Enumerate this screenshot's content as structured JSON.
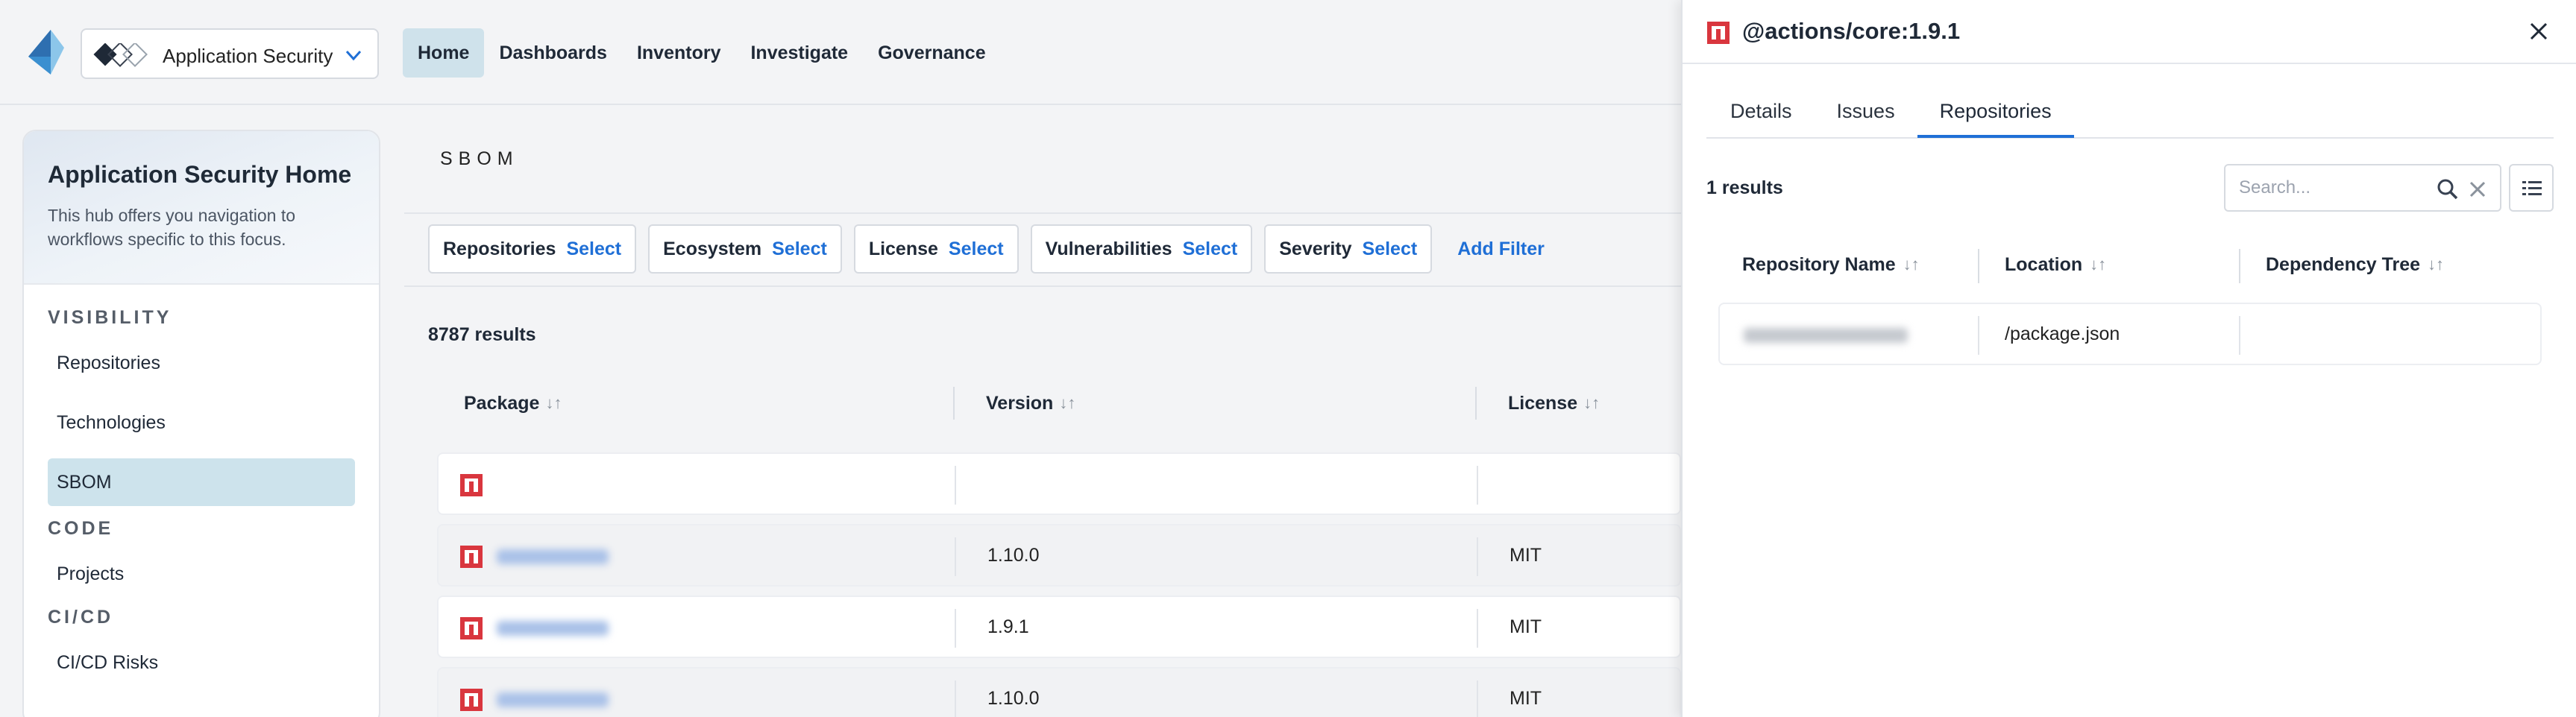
{
  "topnav": {
    "app_selector": "Application Security",
    "links": [
      "Home",
      "Dashboards",
      "Inventory",
      "Investigate",
      "Governance"
    ]
  },
  "sidebar": {
    "title": "Application Security Home",
    "description": "This hub offers you navigation to workflows specific to this focus.",
    "sections": [
      {
        "heading": "VISIBILITY",
        "items": [
          "Repositories",
          "Technologies",
          "SBOM"
        ]
      },
      {
        "heading": "CODE",
        "items": [
          "Projects"
        ]
      },
      {
        "heading": "CI/CD",
        "items": [
          "CI/CD Risks"
        ]
      }
    ],
    "active_item": "SBOM"
  },
  "main": {
    "title": "SBOM",
    "filters": [
      {
        "label": "Repositories",
        "action": "Select"
      },
      {
        "label": "Ecosystem",
        "action": "Select"
      },
      {
        "label": "License",
        "action": "Select"
      },
      {
        "label": "Vulnerabilities",
        "action": "Select"
      },
      {
        "label": "Severity",
        "action": "Select"
      }
    ],
    "add_filter": "Add Filter",
    "results": "8787 results",
    "columns": [
      "Package",
      "Version",
      "License"
    ],
    "rows": [
      {
        "version": "",
        "license": ""
      },
      {
        "version": "1.10.0",
        "license": "MIT"
      },
      {
        "version": "1.9.1",
        "license": "MIT"
      },
      {
        "version": "1.10.0",
        "license": "MIT"
      }
    ]
  },
  "drawer": {
    "title": "@actions/core:1.9.1",
    "tabs": [
      "Details",
      "Issues",
      "Repositories"
    ],
    "active_tab": "Repositories",
    "results": "1 results",
    "search_placeholder": "Search...",
    "columns": [
      "Repository Name",
      "Location",
      "Dependency Tree"
    ],
    "rows": [
      {
        "location": "/package.json",
        "dependency_tree": ""
      }
    ]
  },
  "colors": {
    "accent": "#1f6fd6",
    "active_bg": "#cde3ec",
    "package_icon": "#d9363e"
  }
}
